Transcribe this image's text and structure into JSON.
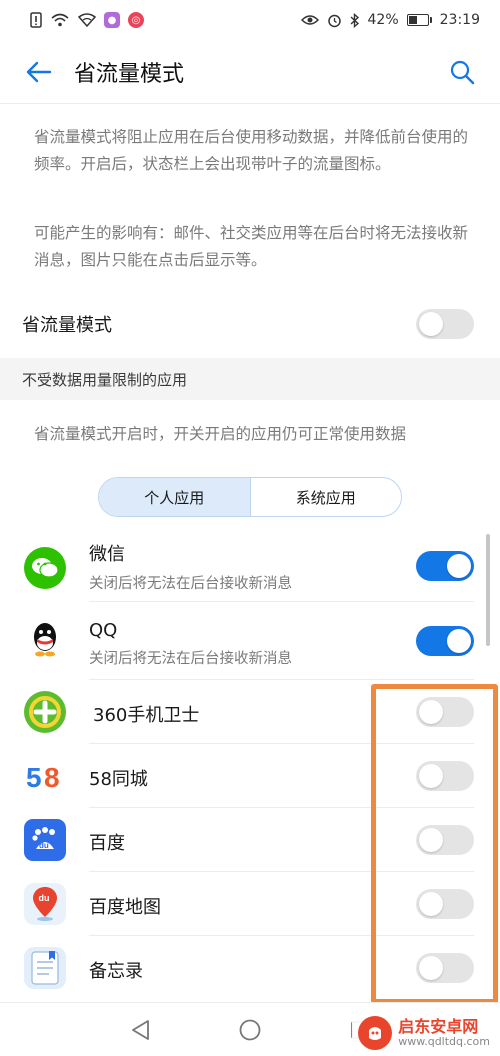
{
  "status_bar": {
    "battery": "42%",
    "time": "23:19",
    "badge1_color": "#b06ad9",
    "badge2_color": "#e8455a"
  },
  "header": {
    "title": "省流量模式",
    "back_icon": "back-arrow-icon",
    "search_icon": "search-icon"
  },
  "description": {
    "paragraph1": "省流量模式将阻止应用在后台使用移动数据，并降低前台使用的频率。开启后，状态栏上会出现带叶子的流量图标。",
    "paragraph2": "可能产生的影响有：邮件、社交类应用等在后台时将无法接收新消息，图片只能在点击后显示等。"
  },
  "data_saver": {
    "label": "省流量模式",
    "enabled": false
  },
  "unrestricted_section": {
    "title": "不受数据用量限制的应用",
    "note": "省流量模式开启时，开关开启的应用仍可正常使用数据",
    "tabs": [
      "个人应用",
      "系统应用"
    ],
    "active_tab": 0
  },
  "apps": [
    {
      "name": "微信",
      "subtitle": "关闭后将无法在后台接收新消息",
      "enabled": true,
      "icon": "wechat-icon"
    },
    {
      "name": "QQ",
      "subtitle": "关闭后将无法在后台接收新消息",
      "enabled": true,
      "icon": "qq-icon"
    },
    {
      "name": "360手机卫士",
      "subtitle": "",
      "enabled": false,
      "icon": "360-security-icon"
    },
    {
      "name": "58同城",
      "subtitle": "",
      "enabled": false,
      "icon": "58-tongcheng-icon"
    },
    {
      "name": "百度",
      "subtitle": "",
      "enabled": false,
      "icon": "baidu-icon"
    },
    {
      "name": "百度地图",
      "subtitle": "",
      "enabled": false,
      "icon": "baidu-map-icon"
    },
    {
      "name": "备忘录",
      "subtitle": "",
      "enabled": false,
      "icon": "memo-icon"
    }
  ],
  "colors": {
    "accent": "#1477e6",
    "highlight": "#ee8a3f"
  },
  "watermark": {
    "name": "启东安卓网",
    "url": "www.qdltdq.com"
  }
}
